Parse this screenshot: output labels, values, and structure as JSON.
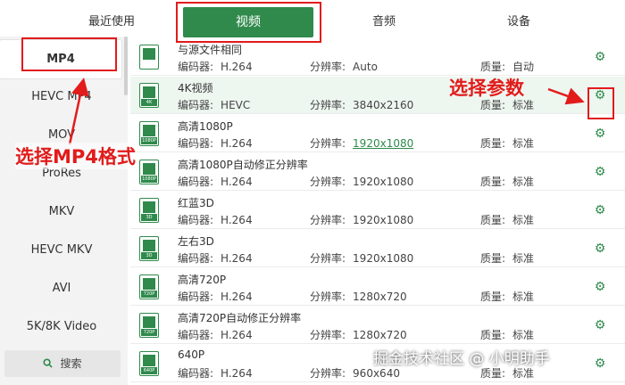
{
  "tabs": [
    {
      "label": "最近使用",
      "active": false
    },
    {
      "label": "视频",
      "active": true
    },
    {
      "label": "音频",
      "active": false
    },
    {
      "label": "设备",
      "active": false
    }
  ],
  "sidebar": {
    "items": [
      "MP4",
      "HEVC MP4",
      "MOV",
      "ProRes",
      "MKV",
      "HEVC MKV",
      "AVI",
      "5K/8K Video"
    ],
    "selected": "MP4",
    "search_label": "搜索",
    "search_icon": "search-icon"
  },
  "labels": {
    "encoder": "编码器:",
    "resolution": "分辨率:",
    "quality": "质量:"
  },
  "rows": [
    {
      "name": "与源文件相同",
      "badge": "",
      "encoder": "H.264",
      "resolution": "Auto",
      "quality": "自动"
    },
    {
      "name": "4K视频",
      "badge": "4K",
      "encoder": "HEVC",
      "resolution": "3840x2160",
      "quality": "标准",
      "highlighted": true
    },
    {
      "name": "高清1080P",
      "badge": "1080P",
      "encoder": "H.264",
      "resolution": "1920x1080",
      "quality": "标准",
      "resolution_link": true
    },
    {
      "name": "高清1080P自动修正分辨率",
      "badge": "1080P",
      "encoder": "H.264",
      "resolution": "1920x1080",
      "quality": "标准"
    },
    {
      "name": "红蓝3D",
      "badge": "3D",
      "encoder": "H.264",
      "resolution": "1920x1080",
      "quality": "标准"
    },
    {
      "name": "左右3D",
      "badge": "3D",
      "encoder": "H.264",
      "resolution": "1920x1080",
      "quality": "标准"
    },
    {
      "name": "高清720P",
      "badge": "720P",
      "encoder": "H.264",
      "resolution": "1280x720",
      "quality": "标准"
    },
    {
      "name": "高清720P自动修正分辨率",
      "badge": "720P",
      "encoder": "H.264",
      "resolution": "1280x720",
      "quality": "标准"
    },
    {
      "name": "640P",
      "badge": "640P",
      "encoder": "H.264",
      "resolution": "960x640",
      "quality": "标准"
    }
  ],
  "annotations": {
    "select_params": "选择参数",
    "select_format": "选择MP4格式"
  },
  "watermark": "掘金技术社区 @ 小明助手",
  "colors": {
    "accent": "#2f8a4c",
    "annotation": "#e21b1b",
    "highlight_row": "#eef6f0"
  }
}
